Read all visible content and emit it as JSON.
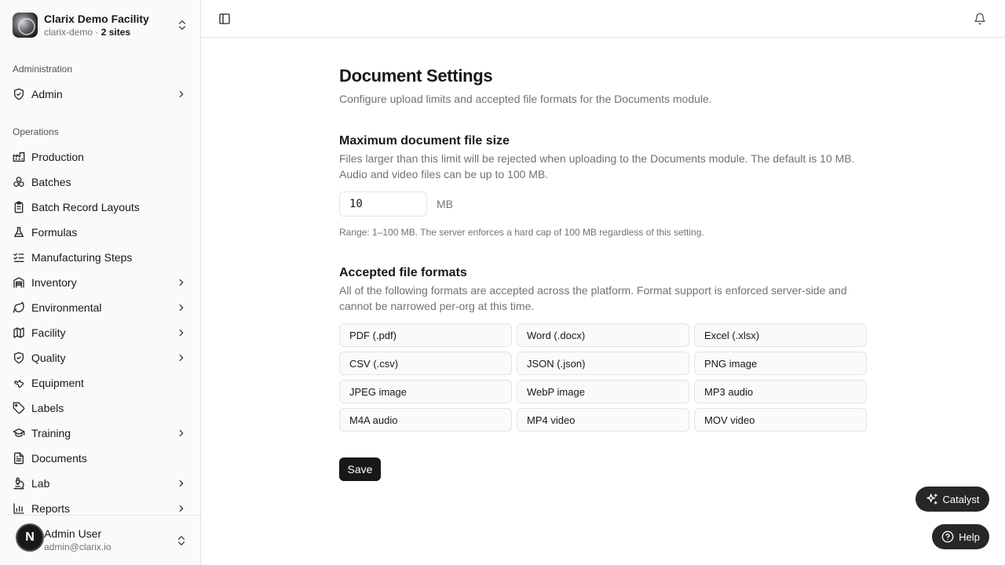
{
  "org": {
    "name": "Clarix Demo Facility",
    "slug": "clarix-demo",
    "separator": " · ",
    "sites": "2 sites"
  },
  "sidebar": {
    "groups": {
      "administration": "Administration",
      "operations": "Operations"
    },
    "items": {
      "admin": "Admin",
      "production": "Production",
      "batches": "Batches",
      "batch_record_layouts": "Batch Record Layouts",
      "formulas": "Formulas",
      "manufacturing_steps": "Manufacturing Steps",
      "inventory": "Inventory",
      "environmental": "Environmental",
      "facility": "Facility",
      "quality": "Quality",
      "equipment": "Equipment",
      "labels": "Labels",
      "training": "Training",
      "documents": "Documents",
      "lab": "Lab",
      "reports": "Reports"
    }
  },
  "user": {
    "initial": "N",
    "name": "Admin User",
    "email": "admin@clarix.io"
  },
  "main": {
    "title": "Document Settings",
    "description": "Configure upload limits and accepted file formats for the Documents module.",
    "size_section": {
      "title": "Maximum document file size",
      "description": "Files larger than this limit will be rejected when uploading to the Documents module. The default is 10 MB. Audio and video files can be up to 100 MB.",
      "value": "10",
      "unit": "MB",
      "hint": "Range: 1–100 MB. The server enforces a hard cap of 100 MB regardless of this setting."
    },
    "formats_section": {
      "title": "Accepted file formats",
      "description": "All of the following formats are accepted across the platform. Format support is enforced server-side and cannot be narrowed per-org at this time.",
      "formats": [
        "PDF (.pdf)",
        "Word (.docx)",
        "Excel (.xlsx)",
        "CSV (.csv)",
        "JSON (.json)",
        "PNG image",
        "JPEG image",
        "WebP image",
        "MP3 audio",
        "M4A audio",
        "MP4 video",
        "MOV video"
      ]
    },
    "save_label": "Save"
  },
  "floating": {
    "catalyst_label": "Catalyst",
    "help_label": "Help"
  }
}
